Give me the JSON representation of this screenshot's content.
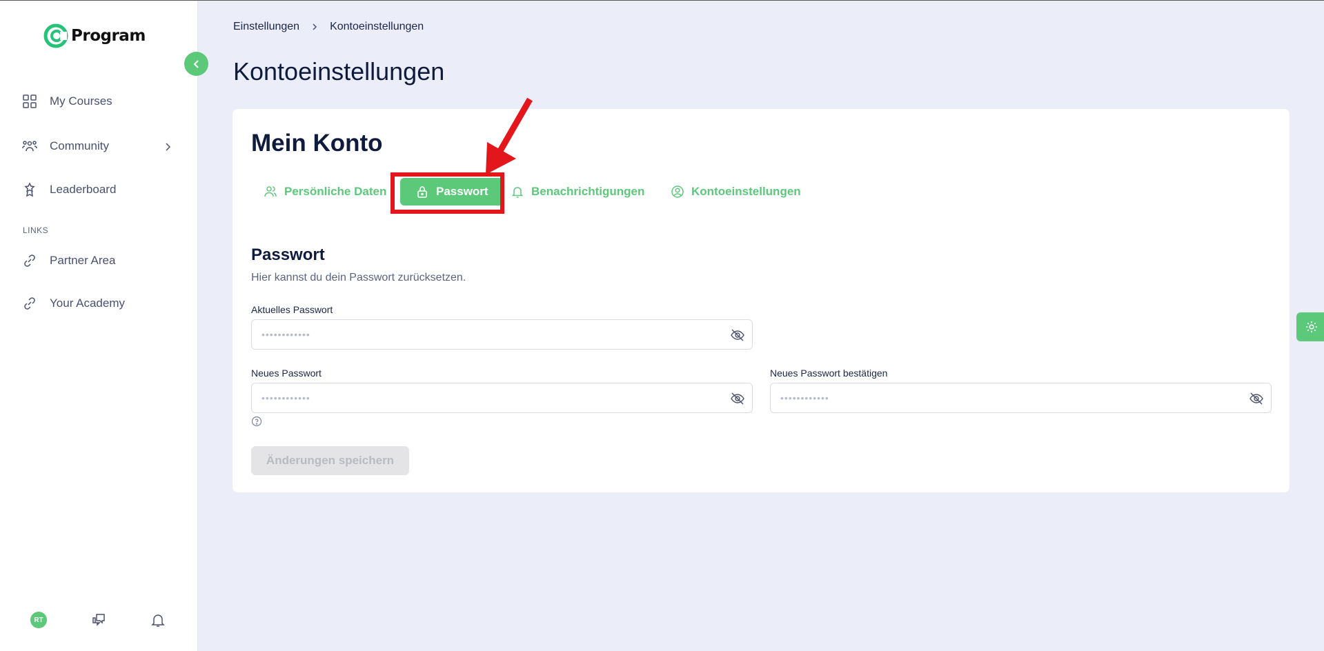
{
  "app": {
    "logo_text": "Program"
  },
  "sidebar": {
    "items": [
      {
        "label": "My Courses",
        "icon": "grid-icon"
      },
      {
        "label": "Community",
        "icon": "people-icon"
      },
      {
        "label": "Leaderboard",
        "icon": "trophy-icon"
      }
    ],
    "section_label": "LINKS",
    "links": [
      {
        "label": "Partner Area",
        "icon": "link-icon"
      },
      {
        "label": "Your Academy",
        "icon": "link-icon"
      }
    ],
    "avatar_initials": "RT"
  },
  "breadcrumb": {
    "parent": "Einstellungen",
    "current": "Kontoeinstellungen"
  },
  "page": {
    "title": "Kontoeinstellungen"
  },
  "card": {
    "title": "Mein Konto",
    "tabs": [
      {
        "label": "Persönliche Daten",
        "icon": "user-icon",
        "active": false
      },
      {
        "label": "Passwort",
        "icon": "lock-icon",
        "active": true
      },
      {
        "label": "Benachrichtigungen",
        "icon": "bell-icon",
        "active": false
      },
      {
        "label": "Kontoeinstellungen",
        "icon": "user-circle-icon",
        "active": false
      }
    ]
  },
  "password_section": {
    "title": "Passwort",
    "description": "Hier kannst du dein Passwort zurücksetzen.",
    "current_label": "Aktuelles Passwort",
    "current_placeholder": "••••••••••••",
    "new_label": "Neues Passwort",
    "new_placeholder": "••••••••••••",
    "confirm_label": "Neues Passwort bestätigen",
    "confirm_placeholder": "••••••••••••",
    "save_label": "Änderungen speichern"
  },
  "colors": {
    "accent": "#5cc87a",
    "highlight": "#e3161b",
    "background": "#ebeef8"
  }
}
